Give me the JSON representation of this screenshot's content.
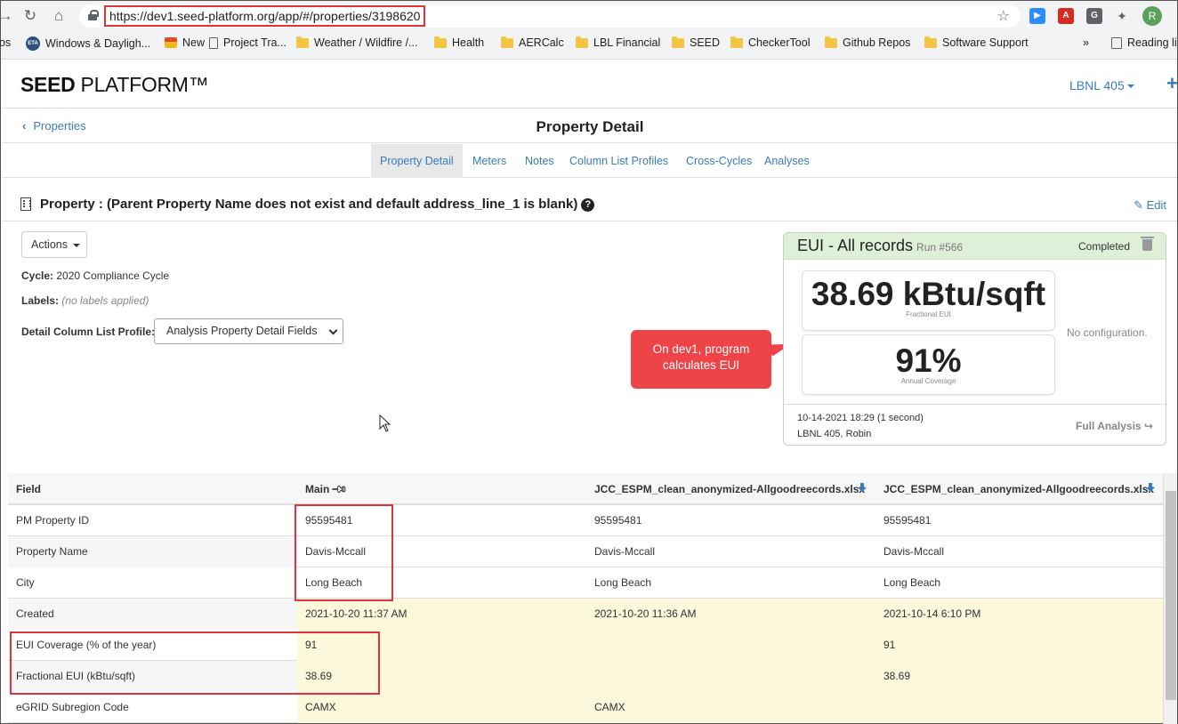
{
  "browser": {
    "url": "https://dev1.seed-platform.org/app/#/properties/3198620",
    "bookmarks": [
      {
        "label": "os",
        "icon": "none"
      },
      {
        "label": "Windows & Dayligh...",
        "icon": "eta-icon"
      },
      {
        "label": "New",
        "icon": "hat-icon"
      },
      {
        "label": "Project Tra...",
        "icon": "doc-icon"
      },
      {
        "label": "Weather / Wildfire /...",
        "icon": "folder-icon"
      },
      {
        "label": "Health",
        "icon": "folder-icon"
      },
      {
        "label": "AERCalc",
        "icon": "folder-icon"
      },
      {
        "label": "LBL Financial",
        "icon": "folder-icon"
      },
      {
        "label": "SEED",
        "icon": "folder-icon"
      },
      {
        "label": "CheckerTool",
        "icon": "folder-icon"
      },
      {
        "label": "Github Repos",
        "icon": "folder-icon"
      },
      {
        "label": "Software Support",
        "icon": "folder-icon"
      }
    ],
    "more": "»",
    "reading_list": "Reading li",
    "avatar_letter": "R",
    "eta_text": "ETA"
  },
  "app": {
    "logo_bold": "SEED",
    "logo_rest": " PLATFORM™",
    "org": "LBNL 405",
    "plus": "+"
  },
  "titlebar": {
    "back": "Properties",
    "title": "Property Detail"
  },
  "tabs": [
    "Property Detail",
    "Meters",
    "Notes",
    "Column List Profiles",
    "Cross-Cycles",
    "Analyses"
  ],
  "property": {
    "title": "Property : (Parent Property Name does not exist and default address_line_1 is blank)",
    "edit": "Edit",
    "actions": "Actions",
    "cycle_label": "Cycle:",
    "cycle_value": "2020 Compliance Cycle",
    "labels_label": "Labels:",
    "labels_value": "(no labels applied)",
    "profile_label": "Detail Column List Profile:",
    "profile_value": "Analysis Property Detail Fields"
  },
  "callout": {
    "line1": "On dev1, program",
    "line2": "calculates EUI"
  },
  "analysis": {
    "title": "EUI - All records",
    "run": "Run #566",
    "status": "Completed",
    "metric1_value": "38.69 kBtu/sqft",
    "metric1_label": "Fractional EUI",
    "metric2_value": "91%",
    "metric2_label": "Annual Coverage",
    "no_config": "No configuration.",
    "date": "10-14-2021 18:29 (1 second)",
    "user": "LBNL 405, Robin",
    "full": "Full Analysis"
  },
  "table": {
    "headers": [
      "Field",
      "Main",
      "JCC_ESPM_clean_anonymized-Allgoodreecords.xlsx",
      "JCC_ESPM_clean_anonymized-Allgoodreecords.xlsx"
    ],
    "rows": [
      {
        "cells": [
          "PM Property ID",
          "95595481",
          "95595481",
          "95595481"
        ],
        "highlight": false
      },
      {
        "cells": [
          "Property Name",
          "Davis-Mccall",
          "Davis-Mccall",
          "Davis-Mccall"
        ],
        "highlight": false
      },
      {
        "cells": [
          "City",
          "Long Beach",
          "Long Beach",
          "Long Beach"
        ],
        "highlight": false
      },
      {
        "cells": [
          "Created",
          "2021-10-20 11:37 AM",
          "2021-10-20 11:36 AM",
          "2021-10-14 6:10 PM"
        ],
        "highlight": true
      },
      {
        "cells": [
          "EUI Coverage (% of the year)",
          "91",
          "",
          "91"
        ],
        "highlight": true
      },
      {
        "cells": [
          "Fractional EUI (kBtu/sqft)",
          "38.69",
          "",
          "38.69"
        ],
        "highlight": true
      },
      {
        "cells": [
          "eGRID Subregion Code",
          "CAMX",
          "CAMX",
          ""
        ],
        "highlight": true
      }
    ]
  },
  "colors": {
    "link": "#3a7bbf",
    "callout": "#ef4447",
    "annotation_box": "#e0333a",
    "card_header": "#dff0d8",
    "row_highlight": "#fdf7dc"
  }
}
